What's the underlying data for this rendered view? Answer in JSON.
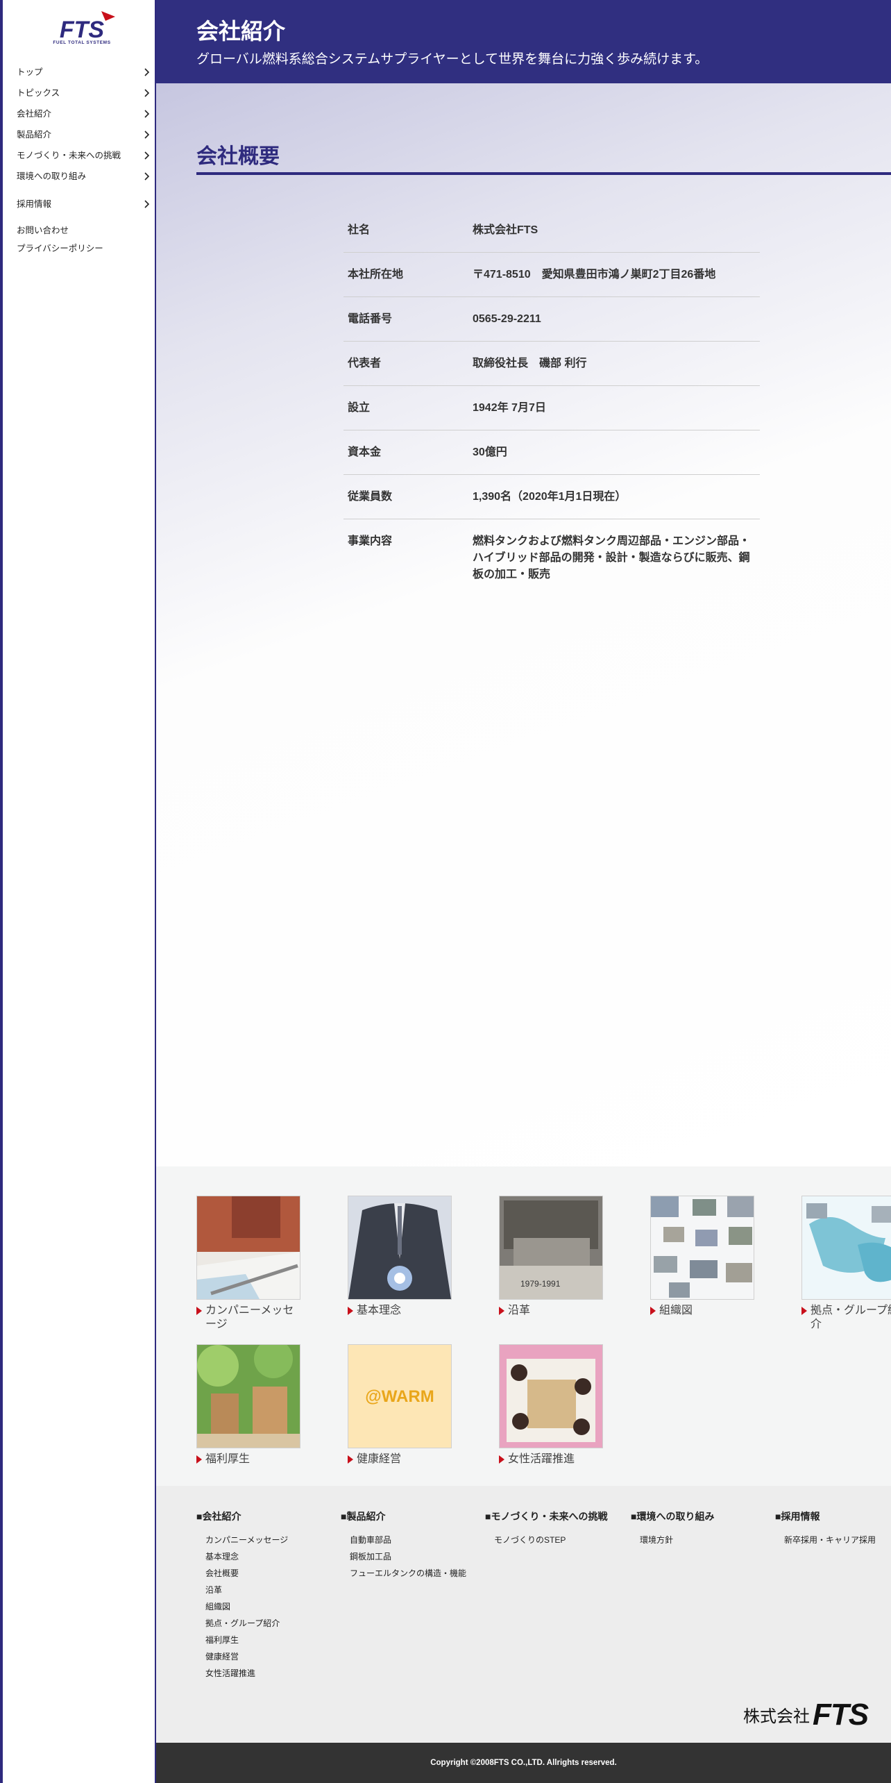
{
  "sidebar": {
    "logo_text": "FTS",
    "logo_subtext": "FUEL TOTAL SYSTEMS",
    "nav": [
      {
        "label": "トップ"
      },
      {
        "label": "トピックス"
      },
      {
        "label": "会社紹介"
      },
      {
        "label": "製品紹介"
      },
      {
        "label": "モノづくり・未来への挑戦"
      },
      {
        "label": "環境への取り組み"
      },
      {
        "label": "採用情報"
      }
    ],
    "contact": "お問い合わせ",
    "privacy": "プライバシーポリシー"
  },
  "header": {
    "title": "会社紹介",
    "subtitle": "グローバル燃料系総合システムサプライヤーとして世界を舞台に力強く歩み続けます。"
  },
  "overview": {
    "title": "会社概要",
    "rows": [
      {
        "key": "社名",
        "value": "株式会社FTS"
      },
      {
        "key": "本社所在地",
        "value": "〒471-8510　愛知県豊田市鴻ノ巣町2丁目26番地"
      },
      {
        "key": "電話番号",
        "value": "0565-29-2211"
      },
      {
        "key": "代表者",
        "value": "取締役社長　磯部 利行"
      },
      {
        "key": "設立",
        "value": "1942年 7月7日"
      },
      {
        "key": "資本金",
        "value": "30億円"
      },
      {
        "key": "従業員数",
        "value": "1,390名（2020年1月1日現在）"
      },
      {
        "key": "事業内容",
        "value": "燃料タンクおよび燃料タンク周辺部品・エンジン部品・ハイブリッド部品の開発・設計・製造ならびに販売、鋼板の加工・販売"
      }
    ]
  },
  "tiles": [
    {
      "label": "カンパニーメッセージ"
    },
    {
      "label": "基本理念"
    },
    {
      "label": "沿革",
      "image_text": "1979-1991"
    },
    {
      "label": "組織図"
    },
    {
      "label": "拠点・グループ紹介"
    },
    {
      "label": "福利厚生"
    },
    {
      "label": "健康経営",
      "image_text": "@WARM"
    },
    {
      "label": "女性活躍推進"
    }
  ],
  "footer": {
    "columns": [
      {
        "title": "■会社紹介",
        "items": [
          "カンパニーメッセージ",
          "基本理念",
          "会社概要",
          "沿革",
          "組織図",
          "拠点・グループ紹介",
          "福利厚生",
          "健康経営",
          "女性活躍推進"
        ]
      },
      {
        "title": "■製品紹介",
        "items": [
          "自動車部品",
          "鋼板加工品",
          "フューエルタンクの構造・機能"
        ]
      },
      {
        "title": "■モノづくり・未来への挑戦",
        "items": [
          "モノづくりのSTEP"
        ]
      },
      {
        "title": "■環境への取り組み",
        "items": [
          "環境方針"
        ]
      },
      {
        "title": "■採用情報",
        "items": [
          "新卒採用・キャリア採用"
        ]
      }
    ],
    "brand_prefix": "株式会社",
    "brand_name": "FTS",
    "copyright": "Copyright ©2008FTS CO.,LTD. Allrights reserved."
  },
  "colors": {
    "brand_navy": "#302f80",
    "accent_red": "#c8101b"
  }
}
